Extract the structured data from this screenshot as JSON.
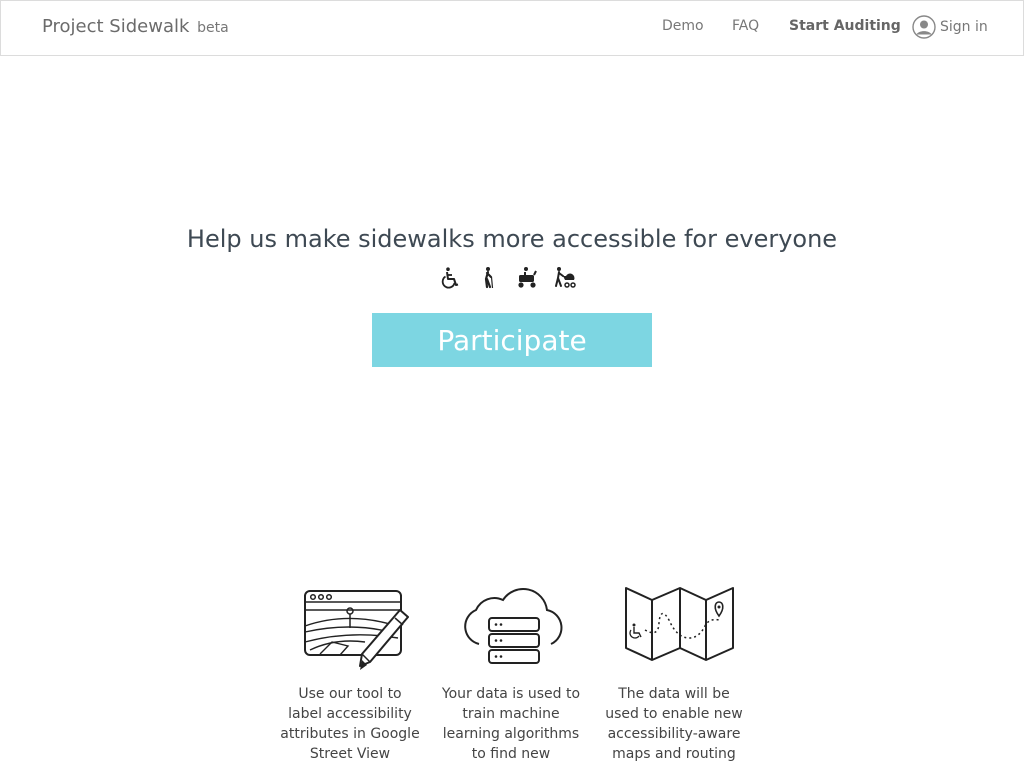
{
  "nav": {
    "brand": "Project Sidewalk",
    "brand_tag": "beta",
    "links": [
      "Demo",
      "FAQ",
      "Start Auditing"
    ],
    "signin": "Sign in"
  },
  "hero": {
    "headline": "Help us make sidewalks more accessible for everyone",
    "icons": [
      "wheelchair-icon",
      "elderly-cane-icon",
      "mobility-scooter-icon",
      "stroller-icon"
    ],
    "cta": "Participate",
    "cta_color": "#7dd6e2"
  },
  "features": [
    {
      "icon": "street-view-pencil-icon",
      "text": "Use our tool to label accessibility attributes in Google Street View"
    },
    {
      "icon": "cloud-server-icon",
      "text": "Your data is used to train machine learning algorithms to find new"
    },
    {
      "icon": "accessibility-map-icon",
      "text": "The data will be used to enable new accessibility-aware maps and routing"
    }
  ]
}
